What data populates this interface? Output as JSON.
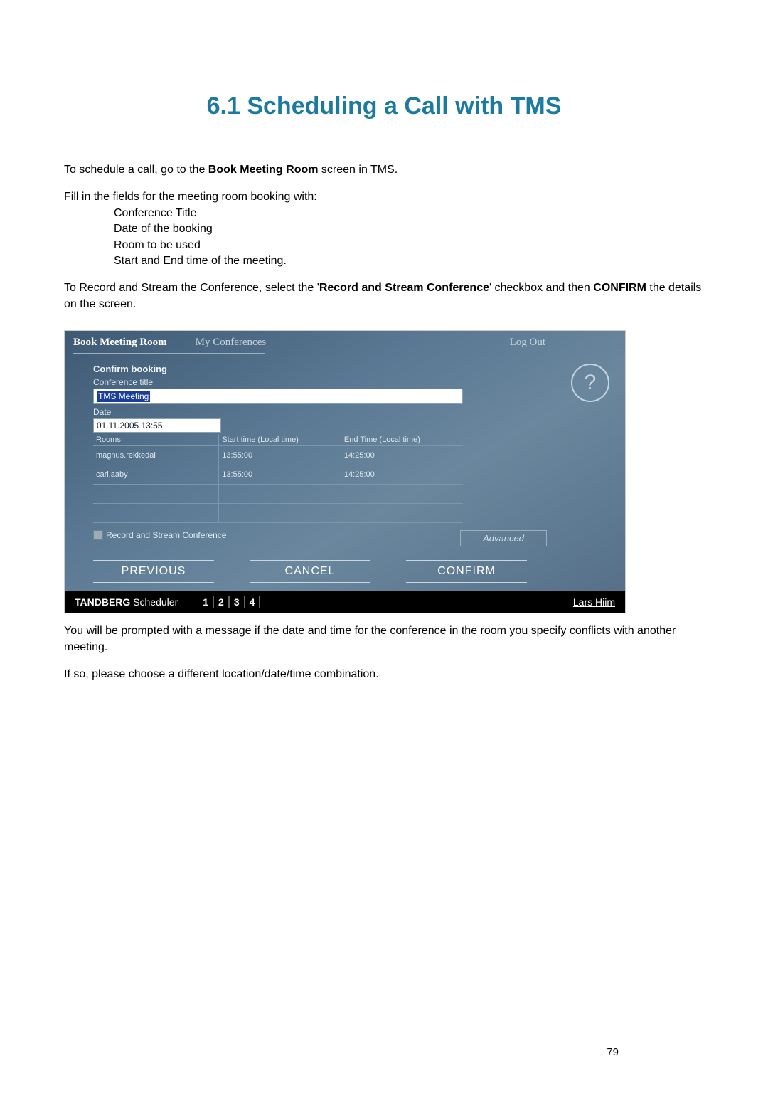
{
  "title": "6.1 Scheduling a Call with TMS",
  "intro": {
    "p1_pre": "To schedule a call, go to the ",
    "p1_bold": "Book Meeting Room",
    "p1_post": " screen in TMS.",
    "p2": "Fill in the fields for the meeting room booking with:",
    "list": {
      "a": "Conference Title",
      "b": "Date of the booking",
      "c": "Room to be used",
      "d": "Start and End time of the meeting."
    },
    "p3_pre": "To Record and Stream the Conference, select the '",
    "p3_bold1": "Record and Stream Conference",
    "p3_mid": "' checkbox and then ",
    "p3_bold2": "CONFIRM",
    "p3_post": " the details on the screen."
  },
  "tms": {
    "tabs": {
      "active": "Book Meeting Room",
      "second": "My Conferences",
      "logout": "Log Out"
    },
    "confirm_heading": "Confirm booking",
    "labels": {
      "conf_title": "Conference title",
      "date": "Date",
      "rooms": "Rooms",
      "start": "Start time (Local time)",
      "end": "End Time (Local time)"
    },
    "fields": {
      "conf_title": "TMS Meeting",
      "date": "01.11.2005 13:55"
    },
    "rows": [
      {
        "room": "magnus.rekkedal",
        "start": "13:55:00",
        "end": "14:25:00"
      },
      {
        "room": "carl.aaby",
        "start": "13:55:00",
        "end": "14:25:00"
      },
      {
        "room": "",
        "start": "",
        "end": ""
      },
      {
        "room": "",
        "start": "",
        "end": ""
      }
    ],
    "checkbox_label": "Record and Stream Conference",
    "advanced": "Advanced",
    "buttons": {
      "prev": "PREVIOUS",
      "cancel": "CANCEL",
      "confirm": "CONFIRM"
    },
    "footer": {
      "brand": "TANDBERG",
      "brand_suffix": " Scheduler",
      "pages": [
        "1",
        "2",
        "3",
        "4"
      ],
      "user": "Lars Hiim"
    }
  },
  "outro": {
    "p1": "You will be prompted with a message if the date and time for the conference in the room you specify conflicts with another meeting.",
    "p2": "If so, please choose a different location/date/time combination."
  },
  "page_num": "79"
}
